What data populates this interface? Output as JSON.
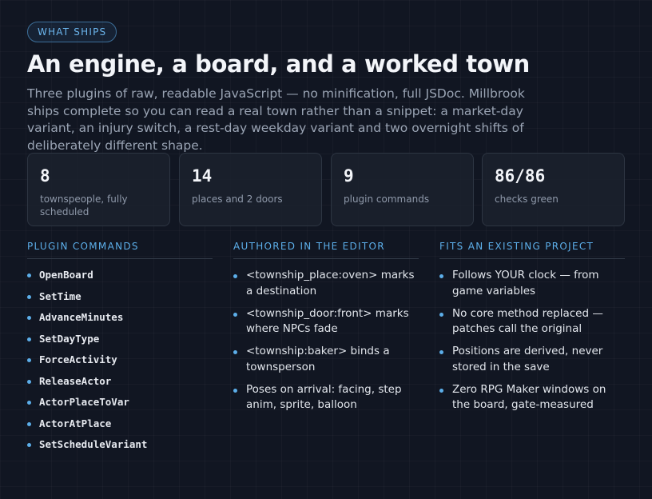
{
  "badge": "WHAT SHIPS",
  "title": "An engine, a board, and a worked town",
  "description": "Three plugins of raw, readable JavaScript — no minification, full JSDoc. Millbrook ships complete so you can read a real town rather than a snippet: a market-day variant, an injury switch, a rest-day weekday variant and two overnight shifts of deliberately different shape.",
  "stats": [
    {
      "value": "8",
      "label": "townspeople, fully scheduled"
    },
    {
      "value": "14",
      "label": "places and 2 doors"
    },
    {
      "value": "9",
      "label": "plugin commands"
    },
    {
      "value": "86/86",
      "label": "checks green"
    }
  ],
  "plugin_commands": {
    "title": "PLUGIN COMMANDS",
    "items": [
      "OpenBoard",
      "SetTime",
      "AdvanceMinutes",
      "SetDayType",
      "ForceActivity",
      "ReleaseActor",
      "ActorPlaceToVar",
      "ActorAtPlace",
      "SetScheduleVariant"
    ]
  },
  "authored": {
    "title": "AUTHORED IN THE EDITOR",
    "items": [
      "<township_place:oven> marks a destination",
      "<township_door:front> marks where NPCs fade",
      "<township:baker> binds a townsperson",
      "Poses on arrival: facing, step anim, sprite, balloon"
    ]
  },
  "fits": {
    "title": "FITS AN EXISTING PROJECT",
    "items": [
      "Follows YOUR clock — from game variables",
      "No core method replaced — patches call the original",
      "Positions are derived, never stored in the save",
      "Zero RPG Maker windows on the board, gate-measured"
    ]
  },
  "colors": {
    "accent": "#5caee9",
    "background": "#111622",
    "card": "#1b212d"
  },
  "icons": {
    "bullet": "bullet-dot-icon"
  }
}
